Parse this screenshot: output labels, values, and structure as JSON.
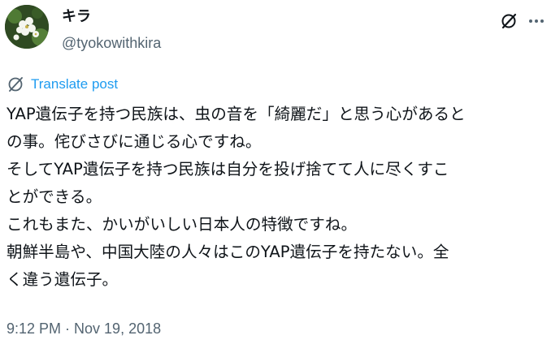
{
  "author": {
    "display_name": "キラ",
    "handle": "@tyokowithkira",
    "avatar_icon": "white-flower-avatar"
  },
  "actions": {
    "grok_icon": "grok-slash-icon",
    "more_icon": "more-dots-icon"
  },
  "translate": {
    "label": "Translate post",
    "icon": "translate-globe-icon"
  },
  "post": {
    "lines": [
      "YAP遺伝子を持つ民族は、虫の音を「綺麗だ」と思う心があると",
      "の事。侘びさびに通じる心ですね。",
      "そしてYAP遺伝子を持つ民族は自分を投げ捨てて人に尽くすこ",
      "とができる。",
      "これもまた、かいがいしい日本人の特徴ですね。",
      "朝鮮半島や、中国大陸の人々はこのYAP遺伝子を持たない。全",
      "く違う遺伝子。"
    ]
  },
  "timestamp": "9:12 PM · Nov 19, 2018",
  "colors": {
    "text": "#0f1419",
    "secondary": "#536471",
    "link": "#1d9bf0"
  }
}
